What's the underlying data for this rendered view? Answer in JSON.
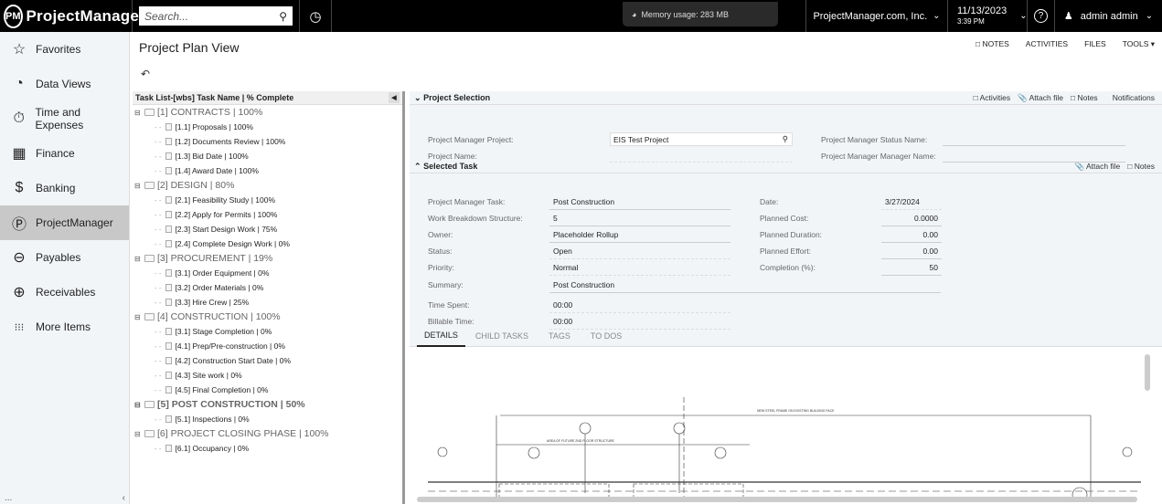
{
  "app": {
    "logo_mark": "PM",
    "logo_text": "ProjectManager",
    "search_placeholder": "Search...",
    "memory_usage": "Memory usage: 283 MB",
    "company": "ProjectManager.com, Inc.",
    "date": "11/13/2023",
    "time": "3:39 PM",
    "help": "?",
    "user": "admin admin"
  },
  "sidebar": {
    "items": [
      {
        "label": "Favorites",
        "icon": "star-icon",
        "glyph": "☆"
      },
      {
        "label": "Data Views",
        "icon": "pie-chart-icon",
        "glyph": "◔"
      },
      {
        "label": "Time and Expenses",
        "icon": "stopwatch-icon",
        "glyph": "⏱"
      },
      {
        "label": "Finance",
        "icon": "calculator-icon",
        "glyph": "▦"
      },
      {
        "label": "Banking",
        "icon": "dollar-icon",
        "glyph": "$"
      },
      {
        "label": "ProjectManager",
        "icon": "pm-icon",
        "glyph": "Ⓟ"
      },
      {
        "label": "Payables",
        "icon": "minus-circle-icon",
        "glyph": "⊖"
      },
      {
        "label": "Receivables",
        "icon": "plus-circle-icon",
        "glyph": "⊕"
      },
      {
        "label": "More Items",
        "icon": "grid-dots-icon",
        "glyph": "⁝⁝⁝"
      }
    ],
    "bottom_left": "...",
    "bottom_right": "‹"
  },
  "page": {
    "title": "Project Plan View",
    "undo_glyph": "↶",
    "actions": [
      "NOTES",
      "ACTIVITIES",
      "FILES",
      "TOOLS ▾"
    ]
  },
  "tree": {
    "header": "Task List-[wbs] Task Name | % Complete",
    "groups": [
      {
        "label": "[1] CONTRACTS | 100%",
        "bold": false,
        "children": [
          "[1.1] Proposals | 100%",
          "[1.2] Documents Review | 100%",
          "[1.3] Bid Date | 100%",
          "[1.4] Award Date | 100%"
        ]
      },
      {
        "label": "[2] DESIGN | 80%",
        "bold": false,
        "children": [
          "[2.1] Feasibility Study | 100%",
          "[2.2] Apply for Permits | 100%",
          "[2.3] Start Design Work | 75%",
          "[2.4] Complete Design Work | 0%"
        ]
      },
      {
        "label": "[3] PROCUREMENT | 19%",
        "bold": false,
        "children": [
          "[3.1] Order Equipment | 0%",
          "[3.2] Order Materials | 0%",
          "[3.3] Hire Crew | 25%"
        ]
      },
      {
        "label": "[4] CONSTRUCTION | 100%",
        "bold": false,
        "children": [
          "[3.1] Stage Completion | 0%",
          "[4.1] Prep/Pre-construction | 0%",
          "[4.2] Construction Start Date | 0%",
          "[4.3] Site work | 0%",
          "[4.5] Final Completion | 0%"
        ]
      },
      {
        "label": "[5] POST CONSTRUCTION | 50%",
        "bold": true,
        "children": [
          "[5.1] Inspections | 0%"
        ]
      },
      {
        "label": "[6] PROJECT CLOSING PHASE | 100%",
        "bold": false,
        "children": [
          "[6.1] Occupancy | 0%"
        ]
      }
    ]
  },
  "project_selection": {
    "title": "Project Selection",
    "actions": [
      "Activities",
      "Attach file",
      "Notes",
      "Notifications"
    ],
    "project_label": "Project Manager Project:",
    "project_value": "EIS Test Project",
    "name_label": "Project Name:",
    "status_name_label": "Project Manager Status Name:",
    "manager_name_label": "Project Manager Manager Name:"
  },
  "selected_task": {
    "title": "Selected Task",
    "actions": [
      "Attach file",
      "Notes"
    ],
    "left_fields": [
      {
        "label": "Project Manager Task:",
        "value": "Post Construction"
      },
      {
        "label": "Work Breakdown Structure:",
        "value": "5"
      },
      {
        "label": "Owner:",
        "value": "Placeholder Rollup"
      },
      {
        "label": "Status:",
        "value": "Open"
      },
      {
        "label": "Priority:",
        "value": "Normal"
      },
      {
        "label": "Summary:",
        "value": "Post Construction"
      },
      {
        "label": "Time Spent:",
        "value": "00:00"
      },
      {
        "label": "Billable Time:",
        "value": "00:00"
      }
    ],
    "right_fields": [
      {
        "label": "Date:",
        "value": "3/27/2024"
      },
      {
        "label": "Planned Cost:",
        "value": "0.0000"
      },
      {
        "label": "Planned Duration:",
        "value": "0.00"
      },
      {
        "label": "Planned Effort:",
        "value": "0.00"
      },
      {
        "label": "Completion (%):",
        "value": "50"
      }
    ]
  },
  "tabs": [
    "DETAILS",
    "CHILD TASKS",
    "TAGS",
    "TO DOS"
  ],
  "drawing": {
    "title_note": "NEW STEEL FRAME ON EXISTING BUILDING FACE",
    "area_note": "AREA OF FUTURE 2ND FLOOR STRUCTURE"
  }
}
